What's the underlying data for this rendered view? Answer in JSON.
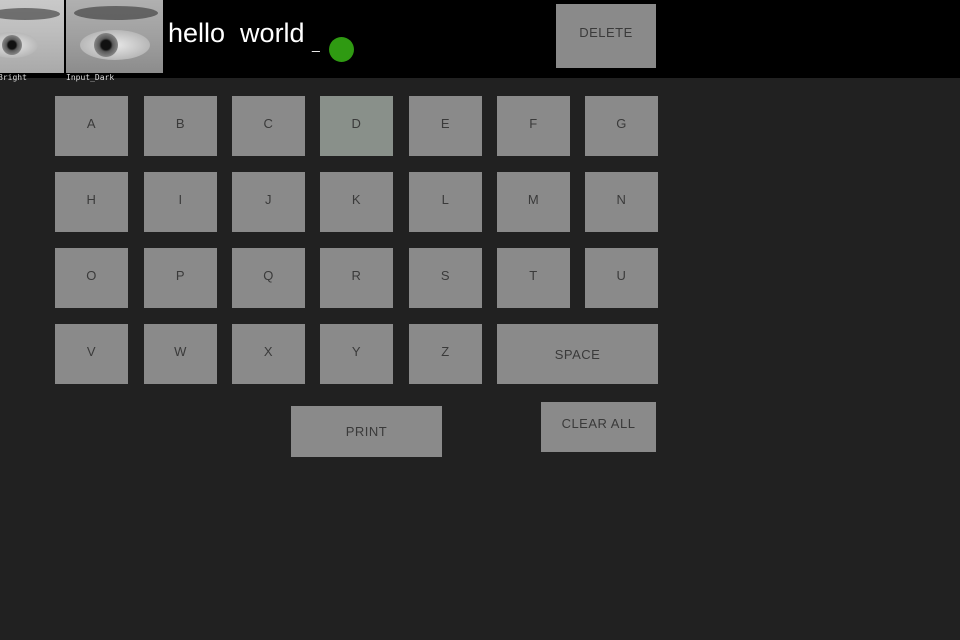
{
  "camera": {
    "bright_label": "Bright",
    "dark_label": "Input_Dark"
  },
  "input": {
    "text": "hello  world",
    "cursor": "_"
  },
  "status": {
    "indicator_color": "#2f9a12"
  },
  "keyboard": {
    "rows": [
      [
        "A",
        "B",
        "C",
        "D",
        "E",
        "F",
        "G"
      ],
      [
        "H",
        "I",
        "J",
        "K",
        "L",
        "M",
        "N"
      ],
      [
        "O",
        "P",
        "Q",
        "R",
        "S",
        "T",
        "U"
      ],
      [
        "V",
        "W",
        "X",
        "Y",
        "Z"
      ]
    ],
    "highlighted": "D",
    "space_label": "SPACE",
    "delete_label": "DELETE",
    "print_label": "PRINT",
    "clear_label": "CLEAR  ALL"
  }
}
